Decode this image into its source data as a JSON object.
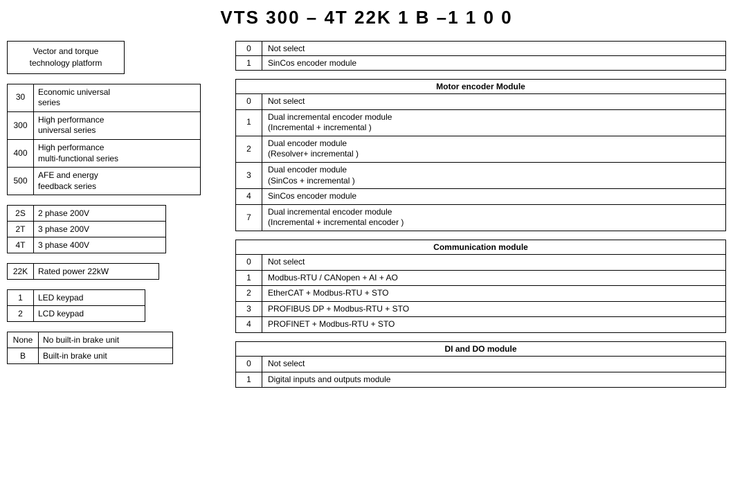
{
  "title": "VTS  300 – 4T  22K 1 B –1 1 0 0",
  "platform": {
    "text": "Vector and torque\ntechnology platform"
  },
  "series": {
    "rows": [
      {
        "code": "30",
        "desc": "Economic universal\nseries"
      },
      {
        "code": "300",
        "desc": "High performance\nuniversal series"
      },
      {
        "code": "400",
        "desc": "High performance\nmulti-functional series"
      },
      {
        "code": "500",
        "desc": "AFE and energy\nfeedback series"
      }
    ]
  },
  "phase": {
    "rows": [
      {
        "code": "2S",
        "desc": "2 phase 200V"
      },
      {
        "code": "2T",
        "desc": "3 phase 200V"
      },
      {
        "code": "4T",
        "desc": "3 phase 400V"
      }
    ]
  },
  "power": {
    "rows": [
      {
        "code": "22K",
        "desc": "Rated power 22kW"
      }
    ]
  },
  "keypad": {
    "rows": [
      {
        "code": "1",
        "desc": "LED keypad"
      },
      {
        "code": "2",
        "desc": "LCD keypad"
      }
    ]
  },
  "brake": {
    "rows": [
      {
        "code": "None",
        "desc": "No built-in brake unit"
      },
      {
        "code": "B",
        "desc": "Built-in brake unit"
      }
    ]
  },
  "sincos": {
    "rows": [
      {
        "code": "0",
        "desc": "Not select"
      },
      {
        "code": "1",
        "desc": "SinCos  encoder module"
      }
    ]
  },
  "motor_encoder": {
    "header": "Motor encoder Module",
    "rows": [
      {
        "code": "0",
        "desc": "Not select"
      },
      {
        "code": "1",
        "desc": "Dual incremental encoder module\n(Incremental + incremental )"
      },
      {
        "code": "2",
        "desc": "Dual encoder module\n(Resolver+ incremental )"
      },
      {
        "code": "3",
        "desc": "Dual encoder module\n(SinCos + incremental )"
      },
      {
        "code": "4",
        "desc": "SinCos  encoder module"
      },
      {
        "code": "7",
        "desc": "Dual incremental encoder module\n(Incremental + incremental encoder )"
      }
    ]
  },
  "communication": {
    "header": "Communication module",
    "rows": [
      {
        "code": "0",
        "desc": "Not select"
      },
      {
        "code": "1",
        "desc": "Modbus-RTU / CANopen + AI + AO"
      },
      {
        "code": "2",
        "desc": "EtherCAT + Modbus-RTU + STO"
      },
      {
        "code": "3",
        "desc": "PROFIBUS DP + Modbus-RTU + STO"
      },
      {
        "code": "4",
        "desc": "PROFINET + Modbus-RTU + STO"
      }
    ]
  },
  "di_do": {
    "header": "DI and DO module",
    "rows": [
      {
        "code": "0",
        "desc": "Not select"
      },
      {
        "code": "1",
        "desc": "Digital inputs and outputs module"
      }
    ]
  }
}
